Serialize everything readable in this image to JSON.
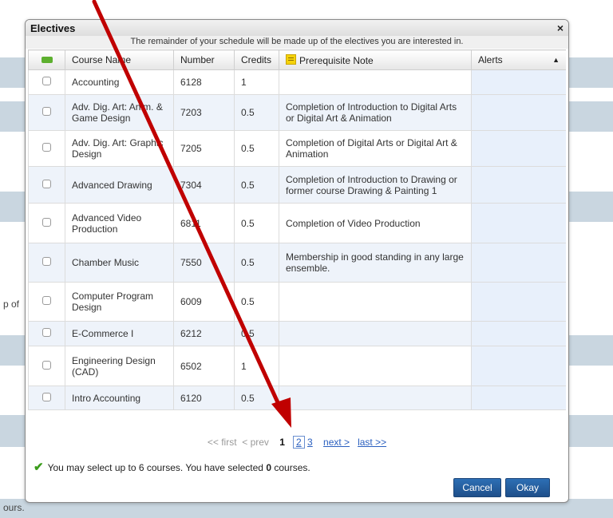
{
  "background": {
    "fragment_left": "p of",
    "fragment_bottom": "ours."
  },
  "modal": {
    "title": "Electives",
    "close_label": "×",
    "subtitle": "The remainder of your schedule will be made up of the electives you are interested in."
  },
  "table": {
    "columns": {
      "select": "",
      "course_name": "Course Name",
      "number": "Number",
      "credits": "Credits",
      "prereq": "Prerequisite Note",
      "alerts": "Alerts"
    },
    "rows": [
      {
        "name": "Accounting",
        "number": "6128",
        "credits": "1",
        "prereq": ""
      },
      {
        "name": "Adv. Dig. Art: Anim. & Game Design",
        "number": "7203",
        "credits": "0.5",
        "prereq": "Completion of Introduction to Digital Arts or Digital Art & Animation"
      },
      {
        "name": "Adv. Dig. Art: Graphic Design",
        "number": "7205",
        "credits": "0.5",
        "prereq": "Completion of Digital Arts or Digital Art & Animation"
      },
      {
        "name": "Advanced Drawing",
        "number": "7304",
        "credits": "0.5",
        "prereq": "Completion of Introduction to Drawing or former course Drawing & Painting 1"
      },
      {
        "name": "Advanced Video Production",
        "number": "6811",
        "credits": "0.5",
        "prereq": "Completion of Video Production"
      },
      {
        "name": "Chamber Music",
        "number": "7550",
        "credits": "0.5",
        "prereq": "Membership in good standing in any large ensemble."
      },
      {
        "name": "Computer Program Design",
        "number": "6009",
        "credits": "0.5",
        "prereq": ""
      },
      {
        "name": "E-Commerce I",
        "number": "6212",
        "credits": "0.5",
        "prereq": ""
      },
      {
        "name": "Engineering Design (CAD)",
        "number": "6502",
        "credits": "1",
        "prereq": ""
      },
      {
        "name": "Intro Accounting",
        "number": "6120",
        "credits": "0.5",
        "prereq": ""
      }
    ]
  },
  "pager": {
    "first": "<< first",
    "prev": "< prev",
    "page1": "1",
    "page2": "2",
    "page3": "3",
    "next": "next >",
    "last": "last >>"
  },
  "status": {
    "prefix": "You may select up to 6 courses. You have selected",
    "count": "0",
    "suffix": "courses."
  },
  "buttons": {
    "cancel": "Cancel",
    "okay": "Okay"
  },
  "colors": {
    "accent": "#1e5799",
    "arrow": "#c00000",
    "check": "#3a9c1b"
  }
}
